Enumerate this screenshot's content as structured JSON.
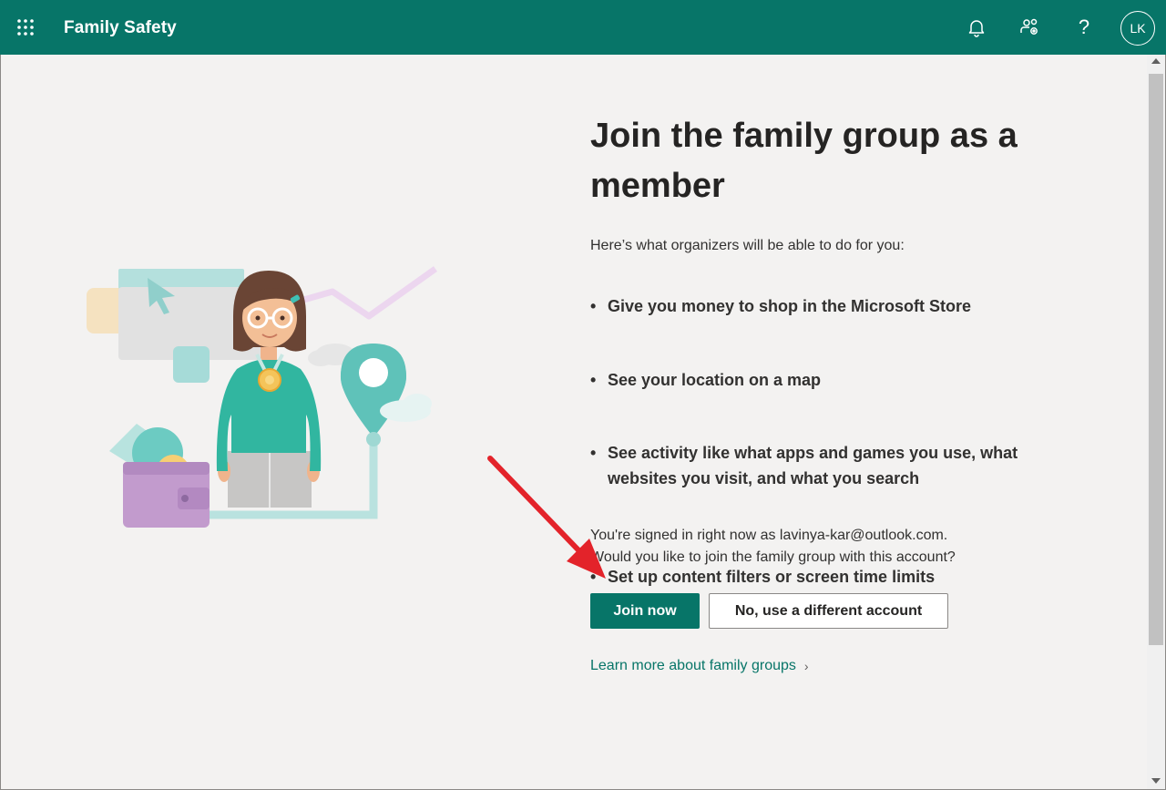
{
  "colors": {
    "brand": "#077568",
    "arrow": "#e3232a"
  },
  "topbar": {
    "app_title": "Family Safety",
    "icons": [
      "app-launcher-icon",
      "bell-icon",
      "people-settings-icon",
      "help-icon"
    ],
    "help_glyph": "?",
    "avatar_initials": "LK"
  },
  "main": {
    "heading": "Join the family group as a member",
    "intro": "Here’s what organizers will be able to do for you:",
    "bullets": [
      "Give you money to shop in the Microsoft Store",
      "See your location on a map",
      "See activity like what apps and games you use, what websites you visit, and what you search",
      "Set up content filters or screen time limits"
    ],
    "signed_in_line1": "You're signed in right now as lavinya-kar@outlook.com.",
    "signed_in_line2": "Would you like to join the family group with this account?",
    "join_button": "Join now",
    "different_account_button": "No, use a different account",
    "learn_more_link": "Learn more about family groups",
    "learn_more_chevron": "›"
  }
}
